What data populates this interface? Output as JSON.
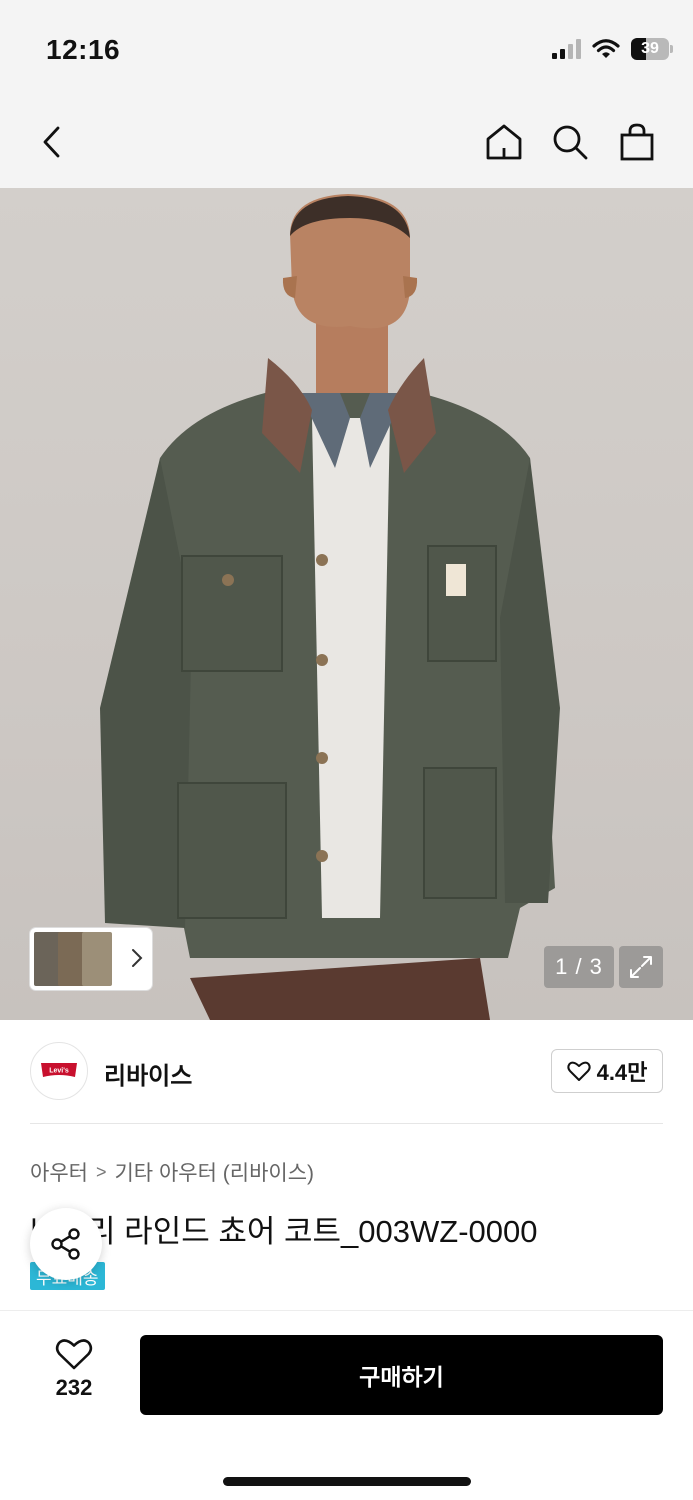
{
  "status_bar": {
    "time": "12:16",
    "battery": "39"
  },
  "nav": {
    "back_icon": "chevron-left-icon",
    "home_icon": "home-icon",
    "search_icon": "search-icon",
    "bag_icon": "shopping-bag-icon"
  },
  "gallery": {
    "page_indicator": "1 / 3",
    "expand_icon": "expand-icon",
    "thumbnail_count": 3
  },
  "brand": {
    "logo_text": "Levi's",
    "name": "리바이스",
    "likes": "4.4만",
    "brand_color": "#c8102e"
  },
  "product": {
    "breadcrumb": [
      "아우터",
      "기타 아우터 (리바이스)"
    ],
    "title": "바드리 라인드 쵸어 코트_003WZ-0000",
    "badge": "무료배송",
    "badge_color": "#2cb7d6"
  },
  "bottom_bar": {
    "wish_count": "232",
    "buy_label": "구매하기"
  }
}
